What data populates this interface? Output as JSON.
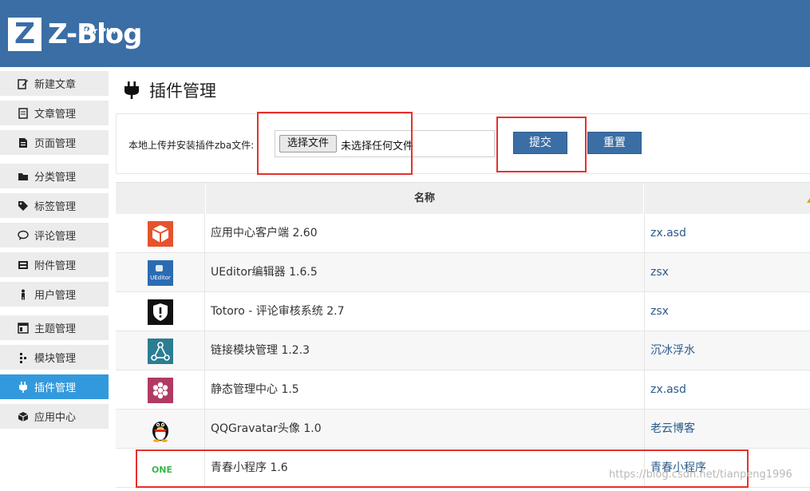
{
  "header": {
    "logo_letter": "Z",
    "logo_text": "Z-Blog",
    "logo_sub": "for PHP"
  },
  "sidebar": {
    "items": [
      {
        "label": "新建文章",
        "icon": "edit-icon"
      },
      {
        "label": "文章管理",
        "icon": "article-icon"
      },
      {
        "label": "页面管理",
        "icon": "page-icon"
      },
      {
        "label": "分类管理",
        "icon": "folder-icon"
      },
      {
        "label": "标签管理",
        "icon": "tag-icon"
      },
      {
        "label": "评论管理",
        "icon": "comment-icon"
      },
      {
        "label": "附件管理",
        "icon": "attachment-icon"
      },
      {
        "label": "用户管理",
        "icon": "user-icon"
      },
      {
        "label": "主题管理",
        "icon": "theme-icon"
      },
      {
        "label": "模块管理",
        "icon": "module-icon"
      },
      {
        "label": "插件管理",
        "icon": "plugin-icon",
        "active": true
      },
      {
        "label": "应用中心",
        "icon": "app-center-icon"
      }
    ]
  },
  "main": {
    "title": "插件管理",
    "upload": {
      "label": "本地上传并安装插件zba文件:",
      "file_button": "选择文件",
      "file_status": "未选择任何文件",
      "submit": "提交",
      "reset": "重置"
    },
    "table": {
      "header_name": "名称",
      "rows": [
        {
          "name": "应用中心客户端 2.60",
          "author": "zx.asd",
          "icon": "app-center-client-icon"
        },
        {
          "name": "UEditor编辑器 1.6.5",
          "author": "zsx",
          "icon": "ueditor-icon",
          "icon_text": "UEditor"
        },
        {
          "name": "Totoro - 评论审核系统 2.7",
          "author": "zsx",
          "icon": "totoro-shield-icon"
        },
        {
          "name": "链接模块管理 1.2.3",
          "author": "沉冰浮水",
          "icon": "link-module-icon"
        },
        {
          "name": "静态管理中心 1.5",
          "author": "zx.asd",
          "icon": "static-manager-icon"
        },
        {
          "name": "QQGravatar头像 1.0",
          "author": "老云博客",
          "icon": "qq-penguin-icon"
        },
        {
          "name": "青春小程序 1.6",
          "author": "青春小程序",
          "icon": "one-logo-icon",
          "icon_text": "ONE"
        }
      ]
    }
  },
  "watermark": "https://blog.csdn.net/tianpeng1996",
  "colors": {
    "header": "#3a6ea5",
    "active_nav": "#3399dd",
    "highlight": "#e8302a",
    "link": "#2a5a8c"
  }
}
